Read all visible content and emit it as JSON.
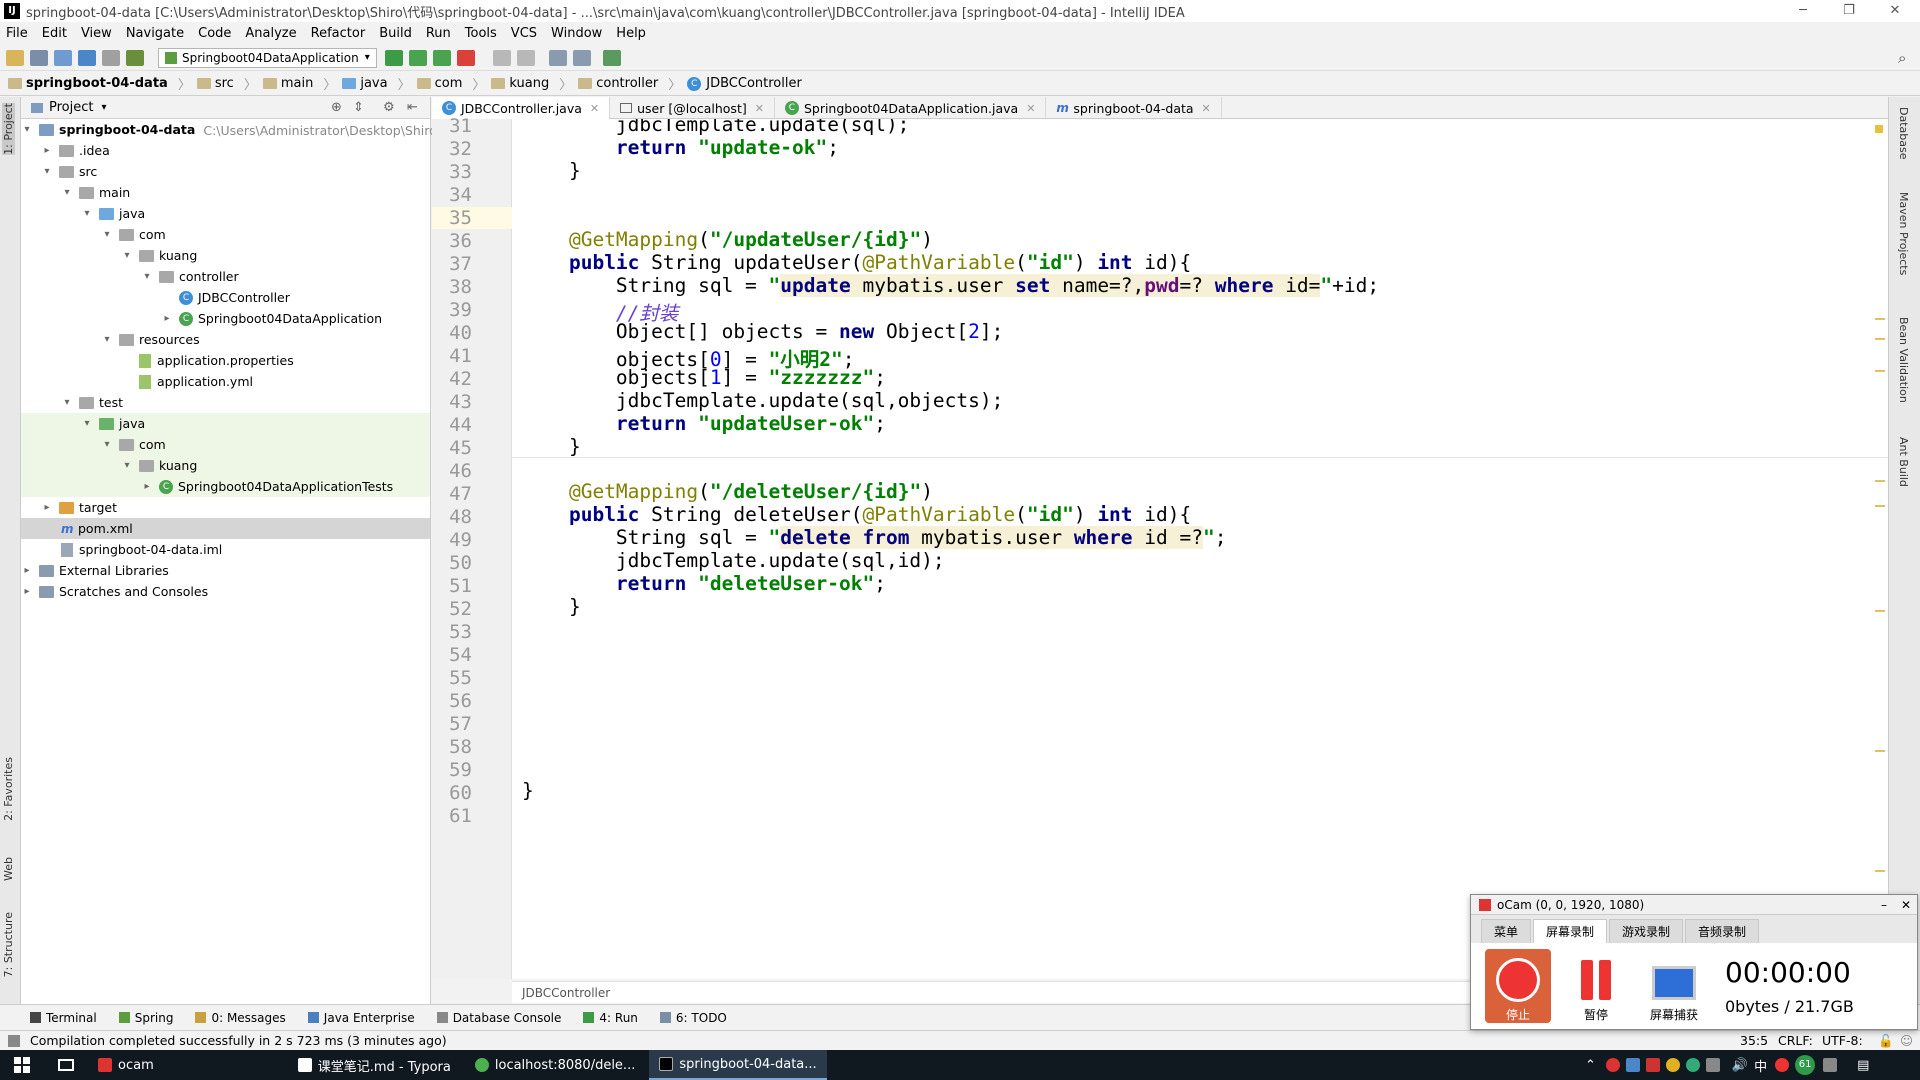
{
  "window": {
    "title": "springboot-04-data [C:\\Users\\Administrator\\Desktop\\Shiro\\代码\\springboot-04-data] - ...\\src\\main\\java\\com\\kuang\\controller\\JDBCController.java [springboot-04-data] - IntelliJ IDEA",
    "app_icon": "IJ"
  },
  "menu": [
    "File",
    "Edit",
    "View",
    "Navigate",
    "Code",
    "Analyze",
    "Refactor",
    "Build",
    "Run",
    "Tools",
    "VCS",
    "Window",
    "Help"
  ],
  "toolbar": {
    "run_config": "Springboot04DataApplication"
  },
  "breadcrumbs": [
    "springboot-04-data",
    "src",
    "main",
    "java",
    "com",
    "kuang",
    "controller",
    "JDBCController"
  ],
  "left_strip": {
    "project": "1: Project",
    "favorites": "2: Favorites",
    "web": "Web",
    "structure": "7: Structure"
  },
  "project_panel": {
    "header": "Project",
    "tree": [
      {
        "label": "springboot-04-data",
        "hint": "C:\\Users\\Administrator\\Desktop\\Shiro\\代码",
        "icon": "module"
      },
      {
        "label": ".idea",
        "icon": "folder"
      },
      {
        "label": "src",
        "icon": "folder"
      },
      {
        "label": "main",
        "icon": "folder"
      },
      {
        "label": "java",
        "icon": "source-folder"
      },
      {
        "label": "com",
        "icon": "folder"
      },
      {
        "label": "kuang",
        "icon": "folder"
      },
      {
        "label": "controller",
        "icon": "folder"
      },
      {
        "label": "JDBCController",
        "icon": "class"
      },
      {
        "label": "Springboot04DataApplication",
        "icon": "spring-class"
      },
      {
        "label": "resources",
        "icon": "folder"
      },
      {
        "label": "application.properties",
        "icon": "spring-file"
      },
      {
        "label": "application.yml",
        "icon": "spring-file"
      },
      {
        "label": "test",
        "icon": "folder"
      },
      {
        "label": "java",
        "icon": "test-folder"
      },
      {
        "label": "com",
        "icon": "folder"
      },
      {
        "label": "kuang",
        "icon": "folder"
      },
      {
        "label": "Springboot04DataApplicationTests",
        "icon": "spring-class"
      },
      {
        "label": "target",
        "icon": "folder-orange"
      },
      {
        "label": "pom.xml",
        "icon": "maven"
      },
      {
        "label": "springboot-04-data.iml",
        "icon": "iml"
      },
      {
        "label": "External Libraries",
        "icon": "library"
      },
      {
        "label": "Scratches and Consoles",
        "icon": "scratch"
      }
    ]
  },
  "editor_tabs": [
    {
      "label": "JDBCController.java",
      "active": true
    },
    {
      "label": "user [@localhost]",
      "active": false
    },
    {
      "label": "Springboot04DataApplication.java",
      "active": false
    },
    {
      "label": "springboot-04-data",
      "active": false
    }
  ],
  "line_numbers": [
    "31",
    "32",
    "33",
    "34",
    "35",
    "36",
    "37",
    "38",
    "39",
    "40",
    "41",
    "42",
    "43",
    "44",
    "45",
    "46",
    "47",
    "48",
    "49",
    "50",
    "51",
    "52",
    "53",
    "54",
    "55",
    "56",
    "57",
    "58",
    "59",
    "60",
    "61"
  ],
  "code": {
    "l31_a": "        jdbcTemplate.update(sql);",
    "l32_kw": "return",
    "l32_str": "\"update-ok\"",
    "l33": "    }",
    "l36_ann": "@GetMapping",
    "l36_str": "\"/updateUser/{id}\"",
    "l37_kw": "public",
    "l37_a": " String updateUser(",
    "l37_ann": "@PathVariable",
    "l37_str": "\"id\"",
    "l37_kw2": "int",
    "l37_b": " id){",
    "l38_a": "String sql = ",
    "l38_q1": "\"",
    "l38_k1": "update",
    "l38_t1": " mybatis.user ",
    "l38_k2": "set",
    "l38_t2": " name=?,",
    "l38_k3": "pwd",
    "l38_t3": "=? ",
    "l38_k4": "where",
    "l38_t4": " id=",
    "l38_q2": "\"",
    "l38_b": "+id;",
    "l39": "//封装",
    "l40_a": "Object[] objects = ",
    "l40_kw": "new",
    "l40_b": " Object[",
    "l40_num": "2",
    "l40_c": "];",
    "l41_a": "objects[",
    "l41_num": "0",
    "l41_b": "] = ",
    "l41_str": "\"小明2\"",
    "l41_c": ";",
    "l42_a": "objects[",
    "l42_num": "1",
    "l42_b": "] = ",
    "l42_str": "\"zzzzzzz\"",
    "l42_c": ";",
    "l43": "jdbcTemplate.update(sql,objects);",
    "l44_kw": "return",
    "l44_str": "\"updateUser-ok\"",
    "l45": "    }",
    "l47_ann": "@GetMapping",
    "l47_str": "\"/deleteUser/{id}\"",
    "l48_kw": "public",
    "l48_a": " String deleteUser(",
    "l48_ann": "@PathVariable",
    "l48_str": "\"id\"",
    "l48_kw2": "int",
    "l48_b": " id){",
    "l49_a": "String sql = ",
    "l49_q1": "\"",
    "l49_k1": "delete from",
    "l49_t1": " mybatis.user ",
    "l49_k2": "where",
    "l49_t2": " id =?",
    "l49_q2": "\"",
    "l49_b": ";",
    "l50": "jdbcTemplate.update(sql,id);",
    "l51_kw": "return",
    "l51_str": "\"deleteUser-ok\"",
    "l52": "    }",
    "l60": "}",
    "semi": ";"
  },
  "editor_breadcrumb": "JDBCController",
  "right_strip": [
    "Database",
    "Maven Projects",
    "Bean Validation",
    "Ant Build"
  ],
  "bottom_tabs": [
    "Terminal",
    "Spring",
    "0: Messages",
    "Java Enterprise",
    "Database Console",
    "4: Run",
    "6: TODO"
  ],
  "status": {
    "message": "Compilation completed successfully in 2 s 723 ms (3 minutes ago)",
    "position": "35:5",
    "line_sep": "CRLF:",
    "encoding": "UTF-8:"
  },
  "taskbar": {
    "items": [
      "ocam",
      "课堂笔记.md - Typora",
      "localhost:8080/dele...",
      "springboot-04-data..."
    ],
    "tray_badge": "61"
  },
  "ocam": {
    "title": "oCam (0, 0, 1920, 1080)",
    "tabs": [
      "菜单",
      "屏幕录制",
      "游戏录制",
      "音频录制"
    ],
    "stop_label": "停止",
    "pause_label": "暂停",
    "capture_label": "屏幕捕获",
    "time": "00:00:00",
    "size": "0bytes / 21.7GB"
  }
}
